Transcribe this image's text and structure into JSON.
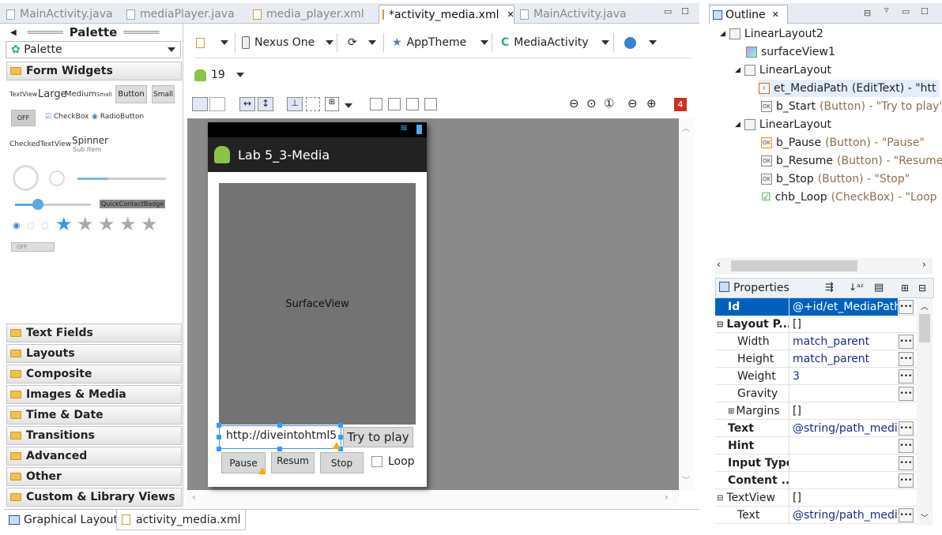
{
  "editor_tabs": [
    {
      "label": "MainActivity.java"
    },
    {
      "label": "mediaPlayer.java"
    },
    {
      "label": "media_player.xml"
    },
    {
      "label": "*activity_media.xml"
    },
    {
      "label": "MainActivity.java"
    }
  ],
  "palette": {
    "title": "Palette",
    "selector": "Palette",
    "form_widgets": "Form Widgets",
    "widgets": {
      "textview": "TextView",
      "large": "Large",
      "medium": "Medium",
      "small": "Small",
      "button": "Button",
      "small_button": "Small",
      "toggle_off": "OFF",
      "checkbox": "CheckBox",
      "radio": "RadioButton",
      "checked_textview": "CheckedTextView",
      "spinner": "Spinner",
      "sub_item": "Sub Item",
      "quick_contact": "QuickContactBadge",
      "switch_off": "OFF"
    },
    "categories": [
      "Text Fields",
      "Layouts",
      "Composite",
      "Images & Media",
      "Time & Date",
      "Transitions",
      "Advanced",
      "Other",
      "Custom & Library Views"
    ]
  },
  "toolbar": {
    "device": "Nexus One",
    "theme": "AppTheme",
    "activity": "MediaActivity",
    "api": "19",
    "error_count": "4"
  },
  "preview": {
    "app_title": "Lab 5_3-Media",
    "surface_label": "SurfaceView",
    "edit_text": "http://diveintohtml5",
    "try_button": "Try to play",
    "pause": "Pause",
    "resume": "Resum",
    "stop": "Stop",
    "loop": "Loop"
  },
  "bottom_tabs": [
    "Graphical Layout",
    "activity_media.xml"
  ],
  "outline": {
    "title": "Outline",
    "rows": [
      {
        "name": "LinearLayout2",
        "type": ""
      },
      {
        "name": "surfaceView1",
        "type": ""
      },
      {
        "name": "LinearLayout",
        "type": ""
      },
      {
        "name": "et_MediaPath",
        "type": "(EditText) - \"htt"
      },
      {
        "name": "b_Start",
        "type": "(Button) - \"Try to play\""
      },
      {
        "name": "LinearLayout",
        "type": ""
      },
      {
        "name": "b_Pause",
        "type": "(Button) - \"Pause\""
      },
      {
        "name": "b_Resume",
        "type": "(Button) - \"Resume"
      },
      {
        "name": "b_Stop",
        "type": "(Button) - \"Stop\""
      },
      {
        "name": "chb_Loop",
        "type": "(CheckBox) - \"Loop"
      }
    ]
  },
  "properties": {
    "title": "Properties",
    "rows": [
      {
        "key": "Id",
        "value": "@+id/et_MediaPath"
      },
      {
        "key": "Layout P...",
        "value": "[]"
      },
      {
        "key": "Width",
        "value": "match_parent"
      },
      {
        "key": "Height",
        "value": "match_parent"
      },
      {
        "key": "Weight",
        "value": "3"
      },
      {
        "key": "Gravity",
        "value": ""
      },
      {
        "key": "Margins",
        "value": "[]"
      },
      {
        "key": "Text",
        "value": "@string/path_media"
      },
      {
        "key": "Hint",
        "value": ""
      },
      {
        "key": "Input Type",
        "value": ""
      },
      {
        "key": "Content ...",
        "value": ""
      },
      {
        "key": "TextView",
        "value": "[]"
      },
      {
        "key": "Text",
        "value": "@string/path_media"
      }
    ]
  },
  "colors": {
    "selection": "#3399ff",
    "id_row": "#0060c0",
    "error_badge": "#d03020"
  }
}
